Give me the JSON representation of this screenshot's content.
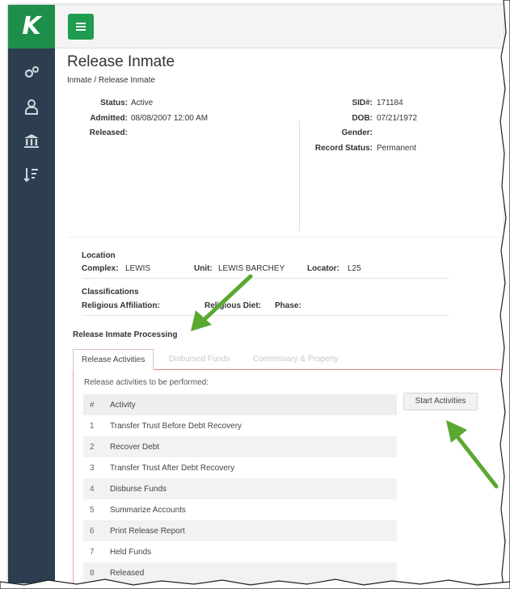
{
  "app": {
    "logo_letter": "K"
  },
  "page": {
    "title": "Release Inmate",
    "breadcrumb": "Inmate / Release Inmate"
  },
  "inmate": {
    "status_label": "Status:",
    "status": "Active",
    "admitted_label": "Admitted:",
    "admitted": "08/08/2007  12:00 AM",
    "released_label": "Released:",
    "released": "",
    "sid_label": "SID#:",
    "sid": "171184",
    "dob_label": "DOB:",
    "dob": "07/21/1972",
    "gender_label": "Gender:",
    "gender": "",
    "record_status_label": "Record Status:",
    "record_status": "Permanent"
  },
  "location": {
    "heading": "Location",
    "complex_label": "Complex:",
    "complex": "LEWIS",
    "unit_label": "Unit:",
    "unit": "LEWIS BARCHEY",
    "locator_label": "Locator:",
    "locator": "L25"
  },
  "classifications": {
    "heading": "Classifications",
    "religious_affiliation_label": "Religious Affiliation:",
    "religious_diet_label": "Religious Diet:",
    "phase_label": "Phase:"
  },
  "processing": {
    "heading": "Release Inmate Processing"
  },
  "tabs": [
    {
      "label": "Release Activities",
      "active": true
    },
    {
      "label": "Disbursed Funds",
      "active": false
    },
    {
      "label": "Commissary & Property",
      "active": false
    }
  ],
  "activities": {
    "caption": "Release activities to be performed:",
    "col_num": "#",
    "col_activity": "Activity",
    "start_button": "Start Activities",
    "rows": [
      {
        "num": "1",
        "name": "Transfer Trust Before Debt Recovery"
      },
      {
        "num": "2",
        "name": "Recover Debt"
      },
      {
        "num": "3",
        "name": "Transfer Trust After Debt Recovery"
      },
      {
        "num": "4",
        "name": "Disburse Funds"
      },
      {
        "num": "5",
        "name": "Summarize Accounts"
      },
      {
        "num": "6",
        "name": "Print Release Report"
      },
      {
        "num": "7",
        "name": "Held Funds"
      },
      {
        "num": "8",
        "name": "Released"
      }
    ]
  },
  "colors": {
    "sidebar": "#2c3e50",
    "brand_green": "#1e9c4f",
    "arrow_green": "#5aa832",
    "tab_border": "#e58a7a"
  },
  "icons": [
    "gears-icon",
    "user-icon",
    "bank-icon",
    "sort-list-icon",
    "hamburger-menu-icon",
    "arrow-annotation"
  ]
}
